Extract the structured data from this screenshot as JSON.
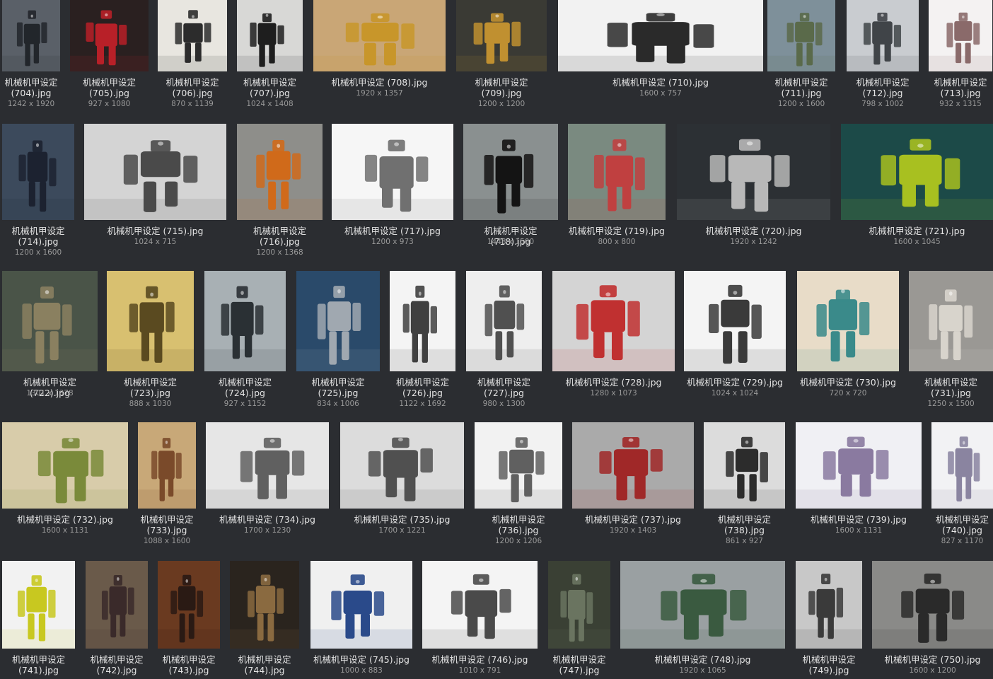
{
  "gallery": {
    "items": [
      {
        "name": "机械机甲设定 (704).jpg",
        "dims": "1242 x 1920",
        "bg": "#5a6068",
        "fg": "#22262b"
      },
      {
        "name": "机械机甲设定 (705).jpg",
        "dims": "927 x 1080",
        "bg": "#2a2020",
        "fg": "#b82028"
      },
      {
        "name": "机械机甲设定 (706).jpg",
        "dims": "870 x 1139",
        "bg": "#e8e6e0",
        "fg": "#2c2c2c"
      },
      {
        "name": "机械机甲设定 (707).jpg",
        "dims": "1024 x 1408",
        "bg": "#d8d8d6",
        "fg": "#1e1e1e"
      },
      {
        "name": "机械机甲设定 (708).jpg",
        "dims": "1920 x 1357",
        "bg": "#c9a676",
        "fg": "#c8962a"
      },
      {
        "name": "机械机甲设定 (709).jpg",
        "dims": "1200 x 1200",
        "bg": "#3a3a34",
        "fg": "#c09030"
      },
      {
        "name": "机械机甲设定 (710).jpg",
        "dims": "1600 x 757",
        "bg": "#f2f2f2",
        "fg": "#2a2a2a"
      },
      {
        "name": "机械机甲设定 (711).jpg",
        "dims": "1200 x 1600",
        "bg": "#7e909a",
        "fg": "#5a6a4a"
      },
      {
        "name": "机械机甲设定 (712).jpg",
        "dims": "798 x 1002",
        "bg": "#c9ccd0",
        "fg": "#404448"
      },
      {
        "name": "机械机甲设定 (713).jpg",
        "dims": "932 x 1315",
        "bg": "#f4f2f2",
        "fg": "#8a6a6a"
      },
      {
        "name": "机械机甲设定 (714).jpg",
        "dims": "1200 x 1600",
        "bg": "#3c4a5c",
        "fg": "#1c2230"
      },
      {
        "name": "机械机甲设定 (715).jpg",
        "dims": "1024 x 715",
        "bg": "#d4d4d4",
        "fg": "#4a4a4a"
      },
      {
        "name": "机械机甲设定 (716).jpg",
        "dims": "1200 x 1368",
        "bg": "#8e8e8a",
        "fg": "#d06a1a"
      },
      {
        "name": "机械机甲设定 (717).jpg",
        "dims": "1200 x 973",
        "bg": "#f6f6f6",
        "fg": "#707070"
      },
      {
        "name": "机械机甲设定 (718).jpg",
        "dims": "1448 x 1500",
        "bg": "#8a9090",
        "fg": "#141414"
      },
      {
        "name": "机械机甲设定 (719).jpg",
        "dims": "800 x 800",
        "bg": "#7a8a80",
        "fg": "#c04040"
      },
      {
        "name": "机械机甲设定 (720).jpg",
        "dims": "1920 x 1242",
        "bg": "#2c3034",
        "fg": "#b8b8b8"
      },
      {
        "name": "机械机甲设定 (721).jpg",
        "dims": "1600 x 1045",
        "bg": "#1c4a48",
        "fg": "#a8c020"
      },
      {
        "name": "机械机甲设定 (722).jpg",
        "dims": "1301 x 1378",
        "bg": "#4a5448",
        "fg": "#8a8060"
      },
      {
        "name": "机械机甲设定 (723).jpg",
        "dims": "888 x 1030",
        "bg": "#d8c070",
        "fg": "#5a4a20"
      },
      {
        "name": "机械机甲设定 (724).jpg",
        "dims": "927 x 1152",
        "bg": "#a8b0b4",
        "fg": "#2a3034"
      },
      {
        "name": "机械机甲设定 (725).jpg",
        "dims": "834 x 1006",
        "bg": "#2a4a6a",
        "fg": "#a0a8b0"
      },
      {
        "name": "机械机甲设定 (726).jpg",
        "dims": "1122 x 1692",
        "bg": "#f4f4f4",
        "fg": "#404040"
      },
      {
        "name": "机械机甲设定 (727).jpg",
        "dims": "980 x 1300",
        "bg": "#eeeeee",
        "fg": "#505050"
      },
      {
        "name": "机械机甲设定 (728).jpg",
        "dims": "1280 x 1073",
        "bg": "#d4d4d4",
        "fg": "#c03030"
      },
      {
        "name": "机械机甲设定 (729).jpg",
        "dims": "1024 x 1024",
        "bg": "#f4f4f4",
        "fg": "#3a3a3a"
      },
      {
        "name": "机械机甲设定 (730).jpg",
        "dims": "720 x 720",
        "bg": "#e8dcc8",
        "fg": "#3a8a8a"
      },
      {
        "name": "机械机甲设定 (731).jpg",
        "dims": "1250 x 1500",
        "bg": "#9a9894",
        "fg": "#d8d4cc"
      },
      {
        "name": "机械机甲设定 (732).jpg",
        "dims": "1600 x 1131",
        "bg": "#d8ccaa",
        "fg": "#7a8a3a"
      },
      {
        "name": "机械机甲设定 (733).jpg",
        "dims": "1088 x 1600",
        "bg": "#c8a878",
        "fg": "#7a4a2a"
      },
      {
        "name": "机械机甲设定 (734).jpg",
        "dims": "1700 x 1230",
        "bg": "#e6e6e6",
        "fg": "#606060"
      },
      {
        "name": "机械机甲设定 (735).jpg",
        "dims": "1700 x 1221",
        "bg": "#dcdcdc",
        "fg": "#505050"
      },
      {
        "name": "机械机甲设定 (736).jpg",
        "dims": "1200 x 1206",
        "bg": "#f2f2f2",
        "fg": "#606060"
      },
      {
        "name": "机械机甲设定 (737).jpg",
        "dims": "1920 x 1403",
        "bg": "#aaaaaa",
        "fg": "#a02828"
      },
      {
        "name": "机械机甲设定 (738).jpg",
        "dims": "861 x 927",
        "bg": "#dcdcdc",
        "fg": "#2c2c2c"
      },
      {
        "name": "机械机甲设定 (739).jpg",
        "dims": "1600 x 1131",
        "bg": "#f0f0f4",
        "fg": "#8a7aa0"
      },
      {
        "name": "机械机甲设定 (740).jpg",
        "dims": "827 x 1170",
        "bg": "#f2f2f4",
        "fg": "#8a84a0"
      },
      {
        "name": "机械机甲设定 (741).jpg",
        "dims": "",
        "bg": "#f2f2f2",
        "fg": "#c8c820"
      },
      {
        "name": "机械机甲设定 (742).jpg",
        "dims": "",
        "bg": "#6a5a4a",
        "fg": "#3a2a2a"
      },
      {
        "name": "机械机甲设定 (743).jpg",
        "dims": "",
        "bg": "#6a3a20",
        "fg": "#2a1a14"
      },
      {
        "name": "机械机甲设定 (744).jpg",
        "dims": "",
        "bg": "#2a241e",
        "fg": "#8a6a40"
      },
      {
        "name": "机械机甲设定 (745).jpg",
        "dims": "1000 x 883",
        "bg": "#f0f0f0",
        "fg": "#2a4a8a"
      },
      {
        "name": "机械机甲设定 (746).jpg",
        "dims": "1010 x 791",
        "bg": "#f4f4f4",
        "fg": "#4a4a4a"
      },
      {
        "name": "机械机甲设定 (747).jpg",
        "dims": "",
        "bg": "#3a4034",
        "fg": "#6a7460"
      },
      {
        "name": "机械机甲设定 (748).jpg",
        "dims": "1920 x 1065",
        "bg": "#9aa0a2",
        "fg": "#3a5a40"
      },
      {
        "name": "机械机甲设定 (749).jpg",
        "dims": "",
        "bg": "#c8c8c8",
        "fg": "#3a3a3a"
      },
      {
        "name": "机械机甲设定 (750).jpg",
        "dims": "1600 x 1200",
        "bg": "#8a8a88",
        "fg": "#2a2a2a"
      }
    ]
  }
}
